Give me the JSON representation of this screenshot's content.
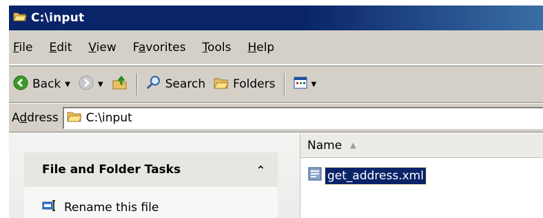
{
  "window": {
    "title": "C:\\input"
  },
  "menu": [
    {
      "pre": "",
      "acc": "F",
      "post": "ile"
    },
    {
      "pre": "",
      "acc": "E",
      "post": "dit"
    },
    {
      "pre": "",
      "acc": "V",
      "post": "iew"
    },
    {
      "pre": "F",
      "acc": "a",
      "post": "vorites"
    },
    {
      "pre": "",
      "acc": "T",
      "post": "ools"
    },
    {
      "pre": "",
      "acc": "H",
      "post": "elp"
    }
  ],
  "toolbar": {
    "back_label": "Back",
    "search_label": "Search",
    "folders_label": "Folders"
  },
  "address": {
    "label_pre": "A",
    "label_acc": "d",
    "label_post": "dress",
    "value": "C:\\input"
  },
  "tasks": {
    "title": "File and Folder Tasks",
    "items": [
      "Rename this file"
    ]
  },
  "list": {
    "column_name": "Name",
    "files": [
      "get_address.xml"
    ]
  }
}
